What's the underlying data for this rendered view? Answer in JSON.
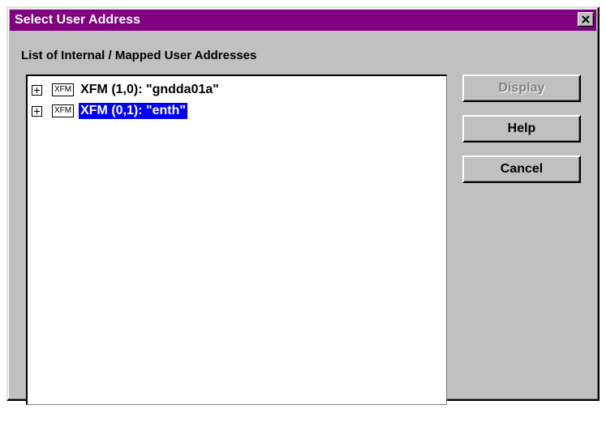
{
  "window": {
    "title": "Select User Address",
    "close_symbol": "close-icon"
  },
  "list": {
    "caption": "List of Internal / Mapped User Addresses",
    "items": [
      {
        "icon_label": "XFM",
        "label": "XFM (1,0): \"gndda01a\"",
        "selected": false
      },
      {
        "icon_label": "XFM",
        "label": "XFM (0,1): \"enth\"",
        "selected": true
      }
    ]
  },
  "buttons": {
    "display": {
      "label": "Display",
      "enabled": false
    },
    "help": {
      "label": "Help",
      "enabled": true
    },
    "cancel": {
      "label": "Cancel",
      "enabled": true
    }
  },
  "colors": {
    "titlebar": "#800080",
    "selection": "#0000ff",
    "face": "#c0c0c0"
  }
}
